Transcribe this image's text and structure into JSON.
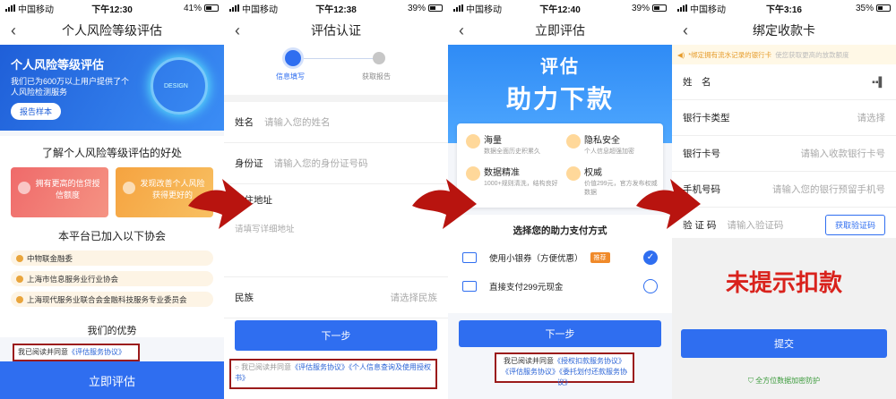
{
  "statusbars": [
    {
      "carrier": "中国移动",
      "time": "下午12:30",
      "battery": "41%"
    },
    {
      "carrier": "中国移动",
      "time": "下午12:38",
      "battery": "39%"
    },
    {
      "carrier": "中国移动",
      "time": "下午12:40",
      "battery": "39%"
    },
    {
      "carrier": "中国移动",
      "time": "下午3:16",
      "battery": "35%"
    }
  ],
  "screen1": {
    "title": "个人风险等级评估",
    "banner_title": "个人风险等级评估",
    "banner_desc": "我们已为600万以上用户提供了个人风险检测服务",
    "report_btn": "报告样本",
    "orb_text": "DESIGN",
    "benefit_title": "了解个人风险等级评估的好处",
    "card_left": "拥有更高的信贷授信额度",
    "card_right": "发现改善个人风险获得更好的",
    "assoc_title": "本平台已加入以下协会",
    "assocs": [
      "中物联金融委",
      "上海市信息服务业行业协会",
      "上海现代服务业联合会金融科技服务专业委员会"
    ],
    "promo_partial": "我们的优势",
    "agree_prefix": "我已阅读并同意",
    "agree_link": "《评估服务协议》",
    "bottom_btn": "立即评估"
  },
  "screen2": {
    "title": "评估认证",
    "step1": "信息填写",
    "step2": "获取报告",
    "name_label": "姓名",
    "name_placeholder": "请输入您的姓名",
    "id_label": "身份证",
    "id_placeholder": "请输入您的身份证号码",
    "addr_label": "现住地址",
    "addr_placeholder": "请填写详细地址",
    "ethnic_label": "民族",
    "ethnic_placeholder": "请选择民族",
    "next_btn": "下一步",
    "agree_text": "我已阅读并同意",
    "agree_link1": "《评估服务协议》",
    "agree_link2": "《个人信息查询及使用授权书》"
  },
  "screen3": {
    "title": "立即评估",
    "banner_line1": "评估",
    "banner_line2": "助力下款",
    "features": [
      {
        "name": "海量",
        "desc": "数据全面历史积累久"
      },
      {
        "name": "隐私安全",
        "desc": "个人信息超强加密"
      },
      {
        "name": "数据精准",
        "desc": "1000+规则清洗，结构良好"
      },
      {
        "name": "权威",
        "desc": "价值299元，官方发布权威数据"
      }
    ],
    "pay_title": "选择您的助力支付方式",
    "pay1": "使用小银券（方便优惠）",
    "pay1_tag": "推荐",
    "pay2": "直接支付299元现金",
    "next_btn": "下一步",
    "agree_text": "我已阅读并同意",
    "agree_link1": "《授权扣款服务协议》",
    "agree_link2": "《评估服务协议》",
    "agree_link3": "《委托划付还款服务协议》"
  },
  "screen4": {
    "title": "绑定收款卡",
    "notice": "*绑定拥有流水记录的银行卡",
    "notice_gray": "使您获取更高的放款额度",
    "name_label": "姓　名",
    "name_value": "▪▪▌",
    "card_type_label": "银行卡类型",
    "card_type_placeholder": "请选择",
    "card_no_label": "银行卡号",
    "card_no_placeholder": "请输入收款银行卡号",
    "phone_label": "手机号码",
    "phone_placeholder": "请输入您的银行预留手机号",
    "code_label": "验 证 码",
    "code_placeholder": "请输入验证码",
    "code_btn": "获取验证码",
    "warning": "未提示扣款",
    "submit_btn": "提交",
    "secure": "全方位数据加密防护"
  }
}
